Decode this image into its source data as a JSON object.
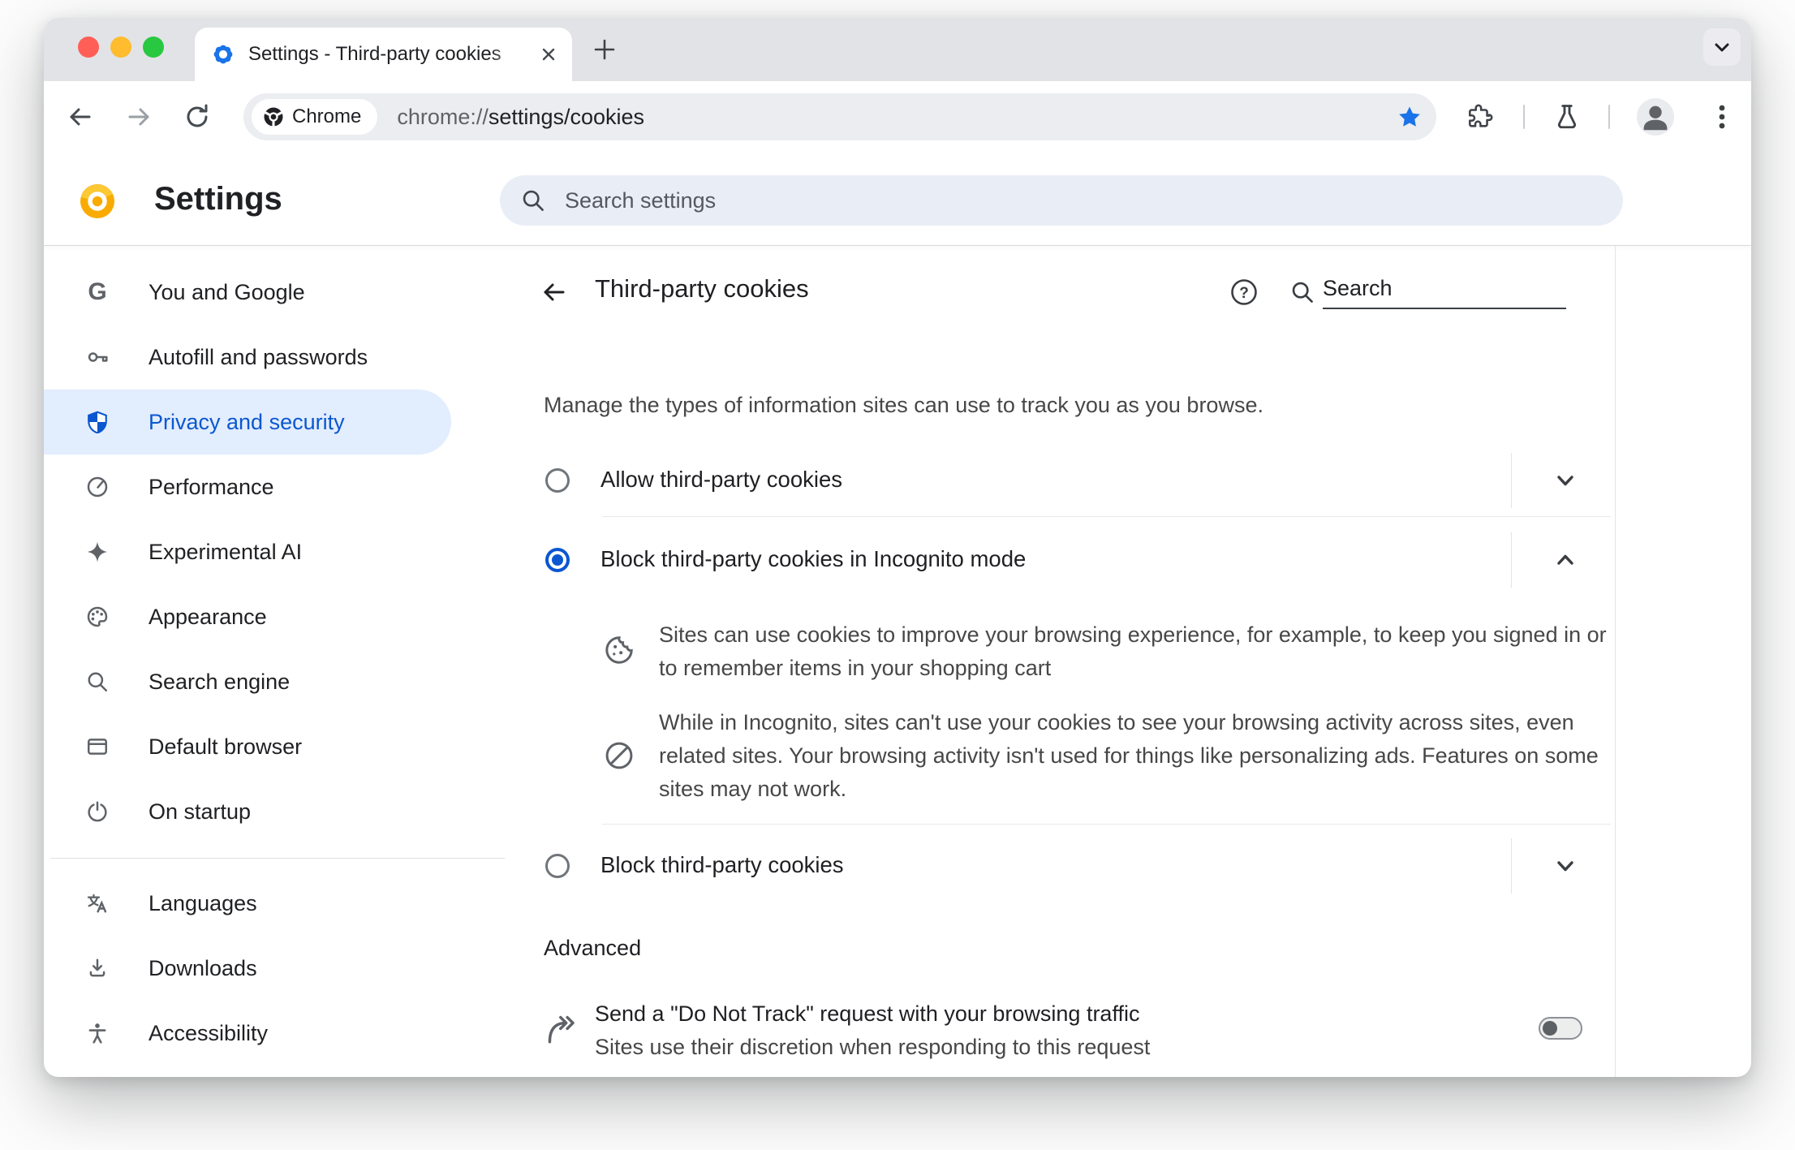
{
  "browser": {
    "tab_title": "Settings - Third-party cookies",
    "new_tab_icon": "plus-icon",
    "tab_list_icon": "chevron-down-icon",
    "toolbar": {
      "site_chip_label": "Chrome",
      "url_scheme": "chrome://",
      "url_path": "settings/cookies",
      "bookmark_state": "filled-star"
    }
  },
  "header": {
    "title": "Settings",
    "search_placeholder": "Search settings"
  },
  "sidebar": {
    "items": [
      {
        "label": "You and Google",
        "icon": "google-g-icon"
      },
      {
        "label": "Autofill and passwords",
        "icon": "key-icon"
      },
      {
        "label": "Privacy and security",
        "icon": "shield-icon",
        "selected": true
      },
      {
        "label": "Performance",
        "icon": "speedometer-icon"
      },
      {
        "label": "Experimental AI",
        "icon": "sparkle-icon"
      },
      {
        "label": "Appearance",
        "icon": "palette-icon"
      },
      {
        "label": "Search engine",
        "icon": "search-icon"
      },
      {
        "label": "Default browser",
        "icon": "browser-window-icon"
      },
      {
        "label": "On startup",
        "icon": "power-icon"
      }
    ],
    "extra_items": [
      {
        "label": "Languages",
        "icon": "translate-icon"
      },
      {
        "label": "Downloads",
        "icon": "download-icon"
      },
      {
        "label": "Accessibility",
        "icon": "accessibility-icon"
      }
    ]
  },
  "content": {
    "title": "Third-party cookies",
    "search_placeholder": "Search",
    "intro": "Manage the types of information sites can use to track you as you browse.",
    "options": [
      {
        "label": "Allow third-party cookies",
        "selected": false,
        "state": "collapsed"
      },
      {
        "label": "Block third-party cookies in Incognito mode",
        "selected": true,
        "state": "expanded",
        "details": [
          {
            "icon": "cookie-icon",
            "text": "Sites can use cookies to improve your browsing experience, for example, to keep you signed in or to remember items in your shopping cart"
          },
          {
            "icon": "blocked-icon",
            "text": "While in Incognito, sites can't use your cookies to see your browsing activity across sites, even related sites. Your browsing activity isn't used for things like personalizing ads. Features on some sites may not work."
          }
        ]
      },
      {
        "label": "Block third-party cookies",
        "selected": false,
        "state": "collapsed"
      }
    ],
    "advanced_label": "Advanced",
    "dnt": {
      "title": "Send a \"Do Not Track\" request with your browsing traffic",
      "subtitle": "Sites use their discretion when responding to this request",
      "enabled": false
    }
  },
  "colors": {
    "accent_blue": "#0b57d0",
    "favicon_blue": "#1a73e8",
    "star_blue": "#1a73e8",
    "selected_item_bg": "#e2edfd",
    "canary_yellow": "#f9ab00",
    "traffic_red": "#ff5f57",
    "traffic_yellow": "#febc2e",
    "traffic_green": "#28c840"
  }
}
